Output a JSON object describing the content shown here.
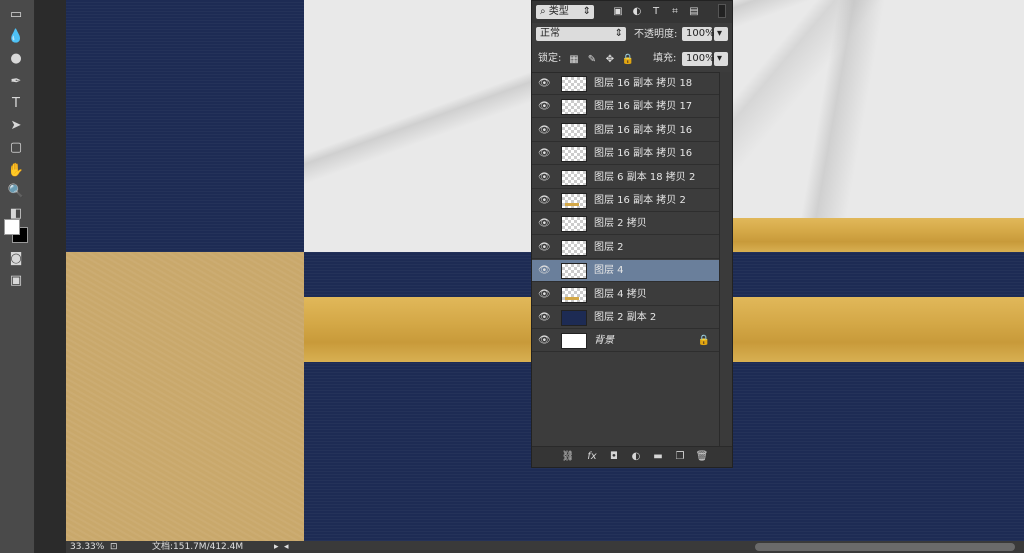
{
  "toolbar": {
    "tools": [
      {
        "name": "marquee-tool-icon",
        "glyph": "▭"
      },
      {
        "name": "blur-tool-icon",
        "glyph": "💧"
      },
      {
        "name": "dodge-tool-icon",
        "glyph": "●"
      },
      {
        "name": "pen-tool-icon",
        "glyph": "✒"
      },
      {
        "name": "type-tool-icon",
        "glyph": "T"
      },
      {
        "name": "path-selection-tool-icon",
        "glyph": "➤"
      },
      {
        "name": "rectangle-tool-icon",
        "glyph": "▢"
      },
      {
        "name": "hand-tool-icon",
        "glyph": "✋"
      },
      {
        "name": "zoom-tool-icon",
        "glyph": "🔍"
      },
      {
        "name": "default-colors-icon",
        "glyph": "◧"
      },
      {
        "name": "quick-mask-icon",
        "glyph": "◙"
      },
      {
        "name": "screen-mode-icon",
        "glyph": "▣"
      }
    ],
    "foreground_color": "#ffffff",
    "background_color": "#000000"
  },
  "layers_panel": {
    "filter_type": "类型",
    "blend_mode": "正常",
    "opacity_label": "不透明度:",
    "opacity_value": "100%",
    "lock_label": "锁定:",
    "fill_label": "填充:",
    "fill_value": "100%",
    "layers": [
      {
        "name": "图层 16 副本 拷贝 18",
        "thumb": "checker",
        "selected": false
      },
      {
        "name": "图层 16 副本 拷贝 17",
        "thumb": "checker",
        "selected": false
      },
      {
        "name": "图层 16 副本 拷贝 16",
        "thumb": "checker",
        "selected": false
      },
      {
        "name": "图层 16 副本 拷贝 16",
        "thumb": "checker",
        "selected": false
      },
      {
        "name": "图层 6 副本 18 拷贝 2",
        "thumb": "checker",
        "selected": false
      },
      {
        "name": "图层 16 副本 拷贝 2",
        "thumb": "checker-gold",
        "selected": false
      },
      {
        "name": "图层 2 拷贝",
        "thumb": "checker",
        "selected": false
      },
      {
        "name": "图层 2",
        "thumb": "checker",
        "selected": false
      },
      {
        "name": "图层 4",
        "thumb": "checker",
        "selected": true
      },
      {
        "name": "图层 4 拷贝",
        "thumb": "checker-gold",
        "selected": false
      },
      {
        "name": "图层 2 副本 2",
        "thumb": "navy",
        "selected": false
      },
      {
        "name": "背景",
        "thumb": "white",
        "selected": false,
        "locked": true
      }
    ],
    "bottom_icons": [
      "link-layers-icon",
      "fx-icon",
      "add-mask-icon",
      "adjustment-layer-icon",
      "new-group-icon",
      "new-layer-icon",
      "trash-icon"
    ]
  },
  "status_bar": {
    "zoom": "33.33%",
    "doc_info": "文档:151.7M/412.4M"
  },
  "colors": {
    "navy": "#1d2b54",
    "gold": "#d4a847",
    "tan": "#c9a86b",
    "marble": "#e9e9e9",
    "selected_layer": "#6a7f9b"
  }
}
